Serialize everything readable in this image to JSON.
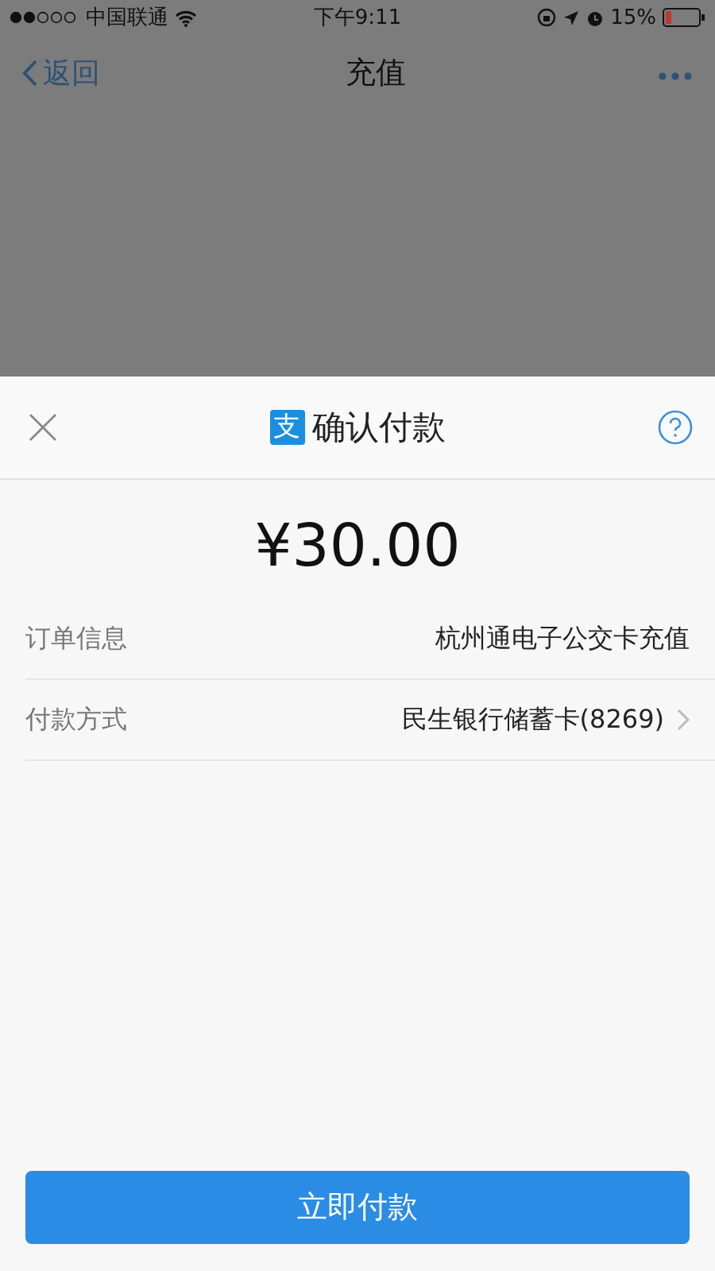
{
  "status_bar": {
    "carrier": "中国联通",
    "time": "下午9:11",
    "battery": "15%"
  },
  "nav_bar": {
    "back": "返回",
    "title": "充值"
  },
  "payment_sheet": {
    "logo_char": "支",
    "title": "确认付款",
    "amount": "¥30.00",
    "rows": [
      {
        "label": "订单信息",
        "value": "杭州通电子公交卡充值",
        "has_chevron": false
      },
      {
        "label": "付款方式",
        "value": "民生银行储蓄卡(8269)",
        "has_chevron": true
      }
    ],
    "pay_button": "立即付款"
  }
}
